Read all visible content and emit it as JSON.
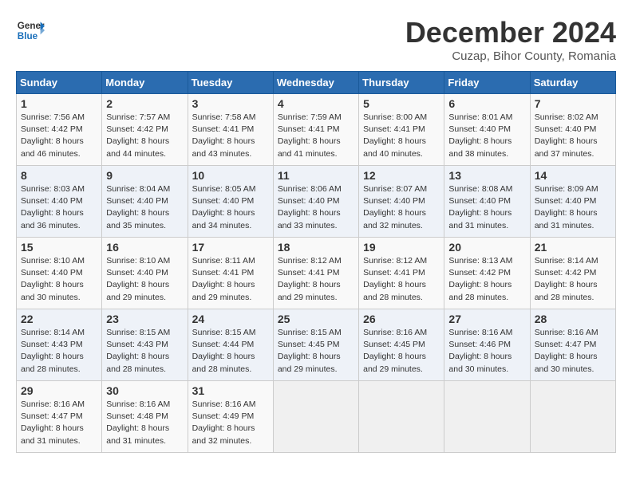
{
  "header": {
    "logo_line1": "General",
    "logo_line2": "Blue",
    "title": "December 2024",
    "subtitle": "Cuzap, Bihor County, Romania"
  },
  "days_of_week": [
    "Sunday",
    "Monday",
    "Tuesday",
    "Wednesday",
    "Thursday",
    "Friday",
    "Saturday"
  ],
  "weeks": [
    [
      {
        "day": "1",
        "sunrise": "7:56 AM",
        "sunset": "4:42 PM",
        "daylight": "8 hours and 46 minutes."
      },
      {
        "day": "2",
        "sunrise": "7:57 AM",
        "sunset": "4:42 PM",
        "daylight": "8 hours and 44 minutes."
      },
      {
        "day": "3",
        "sunrise": "7:58 AM",
        "sunset": "4:41 PM",
        "daylight": "8 hours and 43 minutes."
      },
      {
        "day": "4",
        "sunrise": "7:59 AM",
        "sunset": "4:41 PM",
        "daylight": "8 hours and 41 minutes."
      },
      {
        "day": "5",
        "sunrise": "8:00 AM",
        "sunset": "4:41 PM",
        "daylight": "8 hours and 40 minutes."
      },
      {
        "day": "6",
        "sunrise": "8:01 AM",
        "sunset": "4:40 PM",
        "daylight": "8 hours and 38 minutes."
      },
      {
        "day": "7",
        "sunrise": "8:02 AM",
        "sunset": "4:40 PM",
        "daylight": "8 hours and 37 minutes."
      }
    ],
    [
      {
        "day": "8",
        "sunrise": "8:03 AM",
        "sunset": "4:40 PM",
        "daylight": "8 hours and 36 minutes."
      },
      {
        "day": "9",
        "sunrise": "8:04 AM",
        "sunset": "4:40 PM",
        "daylight": "8 hours and 35 minutes."
      },
      {
        "day": "10",
        "sunrise": "8:05 AM",
        "sunset": "4:40 PM",
        "daylight": "8 hours and 34 minutes."
      },
      {
        "day": "11",
        "sunrise": "8:06 AM",
        "sunset": "4:40 PM",
        "daylight": "8 hours and 33 minutes."
      },
      {
        "day": "12",
        "sunrise": "8:07 AM",
        "sunset": "4:40 PM",
        "daylight": "8 hours and 32 minutes."
      },
      {
        "day": "13",
        "sunrise": "8:08 AM",
        "sunset": "4:40 PM",
        "daylight": "8 hours and 31 minutes."
      },
      {
        "day": "14",
        "sunrise": "8:09 AM",
        "sunset": "4:40 PM",
        "daylight": "8 hours and 31 minutes."
      }
    ],
    [
      {
        "day": "15",
        "sunrise": "8:10 AM",
        "sunset": "4:40 PM",
        "daylight": "8 hours and 30 minutes."
      },
      {
        "day": "16",
        "sunrise": "8:10 AM",
        "sunset": "4:40 PM",
        "daylight": "8 hours and 29 minutes."
      },
      {
        "day": "17",
        "sunrise": "8:11 AM",
        "sunset": "4:41 PM",
        "daylight": "8 hours and 29 minutes."
      },
      {
        "day": "18",
        "sunrise": "8:12 AM",
        "sunset": "4:41 PM",
        "daylight": "8 hours and 29 minutes."
      },
      {
        "day": "19",
        "sunrise": "8:12 AM",
        "sunset": "4:41 PM",
        "daylight": "8 hours and 28 minutes."
      },
      {
        "day": "20",
        "sunrise": "8:13 AM",
        "sunset": "4:42 PM",
        "daylight": "8 hours and 28 minutes."
      },
      {
        "day": "21",
        "sunrise": "8:14 AM",
        "sunset": "4:42 PM",
        "daylight": "8 hours and 28 minutes."
      }
    ],
    [
      {
        "day": "22",
        "sunrise": "8:14 AM",
        "sunset": "4:43 PM",
        "daylight": "8 hours and 28 minutes."
      },
      {
        "day": "23",
        "sunrise": "8:15 AM",
        "sunset": "4:43 PM",
        "daylight": "8 hours and 28 minutes."
      },
      {
        "day": "24",
        "sunrise": "8:15 AM",
        "sunset": "4:44 PM",
        "daylight": "8 hours and 28 minutes."
      },
      {
        "day": "25",
        "sunrise": "8:15 AM",
        "sunset": "4:45 PM",
        "daylight": "8 hours and 29 minutes."
      },
      {
        "day": "26",
        "sunrise": "8:16 AM",
        "sunset": "4:45 PM",
        "daylight": "8 hours and 29 minutes."
      },
      {
        "day": "27",
        "sunrise": "8:16 AM",
        "sunset": "4:46 PM",
        "daylight": "8 hours and 30 minutes."
      },
      {
        "day": "28",
        "sunrise": "8:16 AM",
        "sunset": "4:47 PM",
        "daylight": "8 hours and 30 minutes."
      }
    ],
    [
      {
        "day": "29",
        "sunrise": "8:16 AM",
        "sunset": "4:47 PM",
        "daylight": "8 hours and 31 minutes."
      },
      {
        "day": "30",
        "sunrise": "8:16 AM",
        "sunset": "4:48 PM",
        "daylight": "8 hours and 31 minutes."
      },
      {
        "day": "31",
        "sunrise": "8:16 AM",
        "sunset": "4:49 PM",
        "daylight": "8 hours and 32 minutes."
      },
      null,
      null,
      null,
      null
    ]
  ],
  "labels": {
    "sunrise": "Sunrise:",
    "sunset": "Sunset:",
    "daylight": "Daylight:"
  }
}
